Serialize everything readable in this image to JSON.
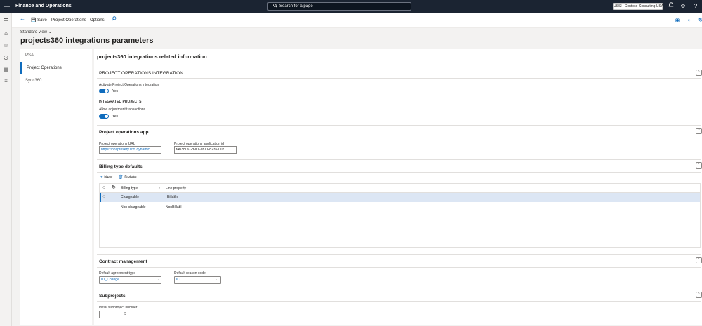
{
  "topbar": {
    "app_name": "Finance and Operations",
    "search_placeholder": "Search for a page",
    "company": "USSI | Contoso Consulting USA"
  },
  "command_bar": {
    "save_label": "Save",
    "project_operations_label": "Project Operations",
    "options_label": "Options"
  },
  "page": {
    "view": "Standard view",
    "title": "projects360 integrations parameters"
  },
  "tabs": [
    {
      "label": "PSA"
    },
    {
      "label": "Project Operations"
    },
    {
      "label": "Sync360"
    }
  ],
  "content": {
    "heading": "projects360 integrations related information",
    "pom_integration": {
      "header": "PROJECT OPERATIONS INTEGRATION",
      "activate_label": "Activate Project Operations integration",
      "activate_value": "Yes",
      "integrated_projects_label": "INTEGRATED PROJECTS",
      "allow_adjustment_label": "Allow adjustment transactions",
      "allow_adjustment_value": "Yes"
    },
    "po_app": {
      "header": "Project operations app",
      "url_label": "Project operations URL",
      "url_value": "https://hpsprosery.crm.dynamic...",
      "app_id_label": "Project operations application id",
      "app_id_value": "f4b3c1a7-d9c1-eb11-8235-002..."
    },
    "billing": {
      "header": "Billing type defaults",
      "new_label": "New",
      "delete_label": "Delete",
      "columns": [
        "Billing type",
        "Line property"
      ],
      "rows": [
        {
          "billing_type": "Chargeable",
          "line_property": "Billable"
        },
        {
          "billing_type": "Non-chargeable",
          "line_property": "NonBillabl"
        }
      ]
    },
    "contract": {
      "header": "Contract management",
      "agreement_label": "Default agreement type",
      "agreement_value": "01_Change",
      "reason_label": "Default reason code",
      "reason_value": "IC"
    },
    "subprojects": {
      "header": "Subprojects",
      "initial_label": "Initial subproject number",
      "initial_value": "5"
    }
  },
  "colors": {
    "accent": "#0f6cbd",
    "topbar_bg": "#1b2432",
    "selected_row": "#dce6f4"
  }
}
